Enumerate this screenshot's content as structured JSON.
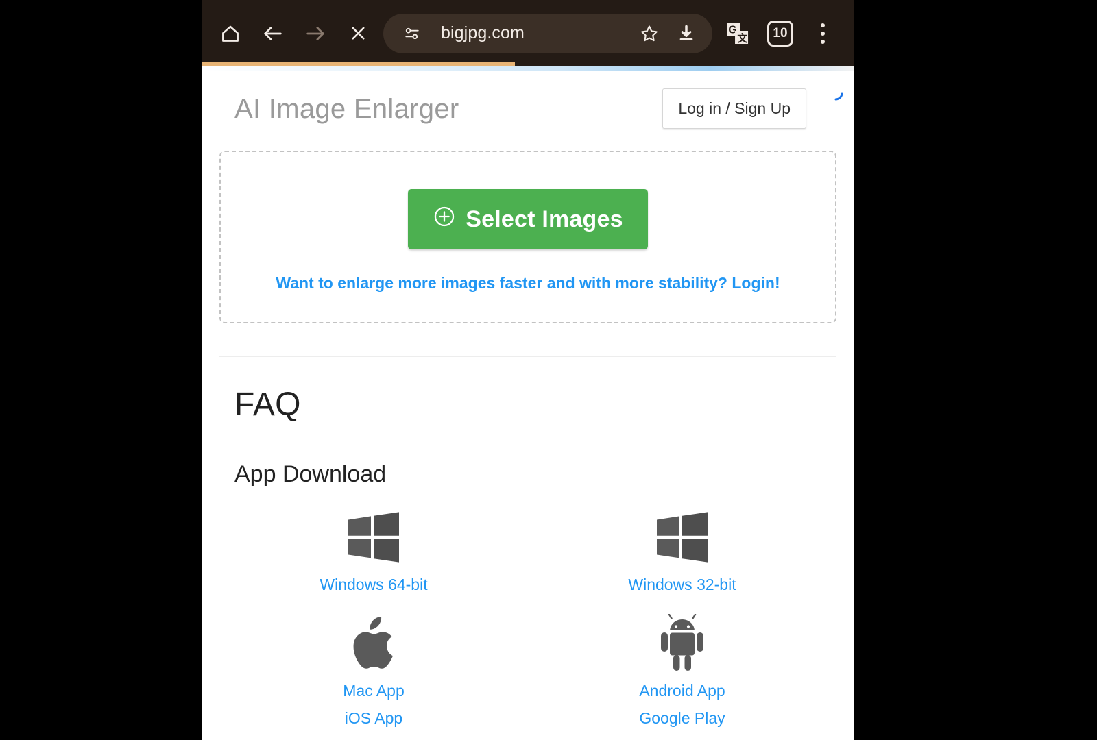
{
  "browser": {
    "toolbar": {
      "home_icon": "home-icon",
      "back_icon": "back-arrow-icon",
      "forward_icon": "forward-arrow-icon",
      "stop_icon": "stop-loading-icon",
      "translate_icon": "google-translate-icon",
      "menu_icon": "overflow-menu-icon",
      "tab_count": "10"
    },
    "omnibox": {
      "permissions_icon": "site-settings-icon",
      "url": "bigjpg.com",
      "bookmark_icon": "star-icon",
      "download_icon": "download-icon"
    },
    "progress": {
      "percent": 48,
      "color": "#e8b475"
    }
  },
  "page": {
    "title": "AI Image Enlarger",
    "login_button": "Log in / Sign Up",
    "spinner_icon": "loading-spinner-icon",
    "dropzone": {
      "plus_icon": "plus-circle-icon",
      "button_label": "Select Images",
      "hint": "Want to enlarge more images faster and with more stability? Login!",
      "button_color": "#4cb050",
      "link_color": "#2196f3"
    },
    "faq": {
      "heading": "FAQ",
      "app_download_heading": "App Download",
      "apps": [
        {
          "icon": "windows-logo-icon",
          "links": [
            "Windows 64-bit"
          ]
        },
        {
          "icon": "windows-logo-icon",
          "links": [
            "Windows 32-bit"
          ]
        },
        {
          "icon": "apple-logo-icon",
          "links": [
            "Mac App",
            "iOS App"
          ]
        },
        {
          "icon": "android-logo-icon",
          "links": [
            "Android App",
            "Google Play"
          ]
        }
      ]
    }
  }
}
